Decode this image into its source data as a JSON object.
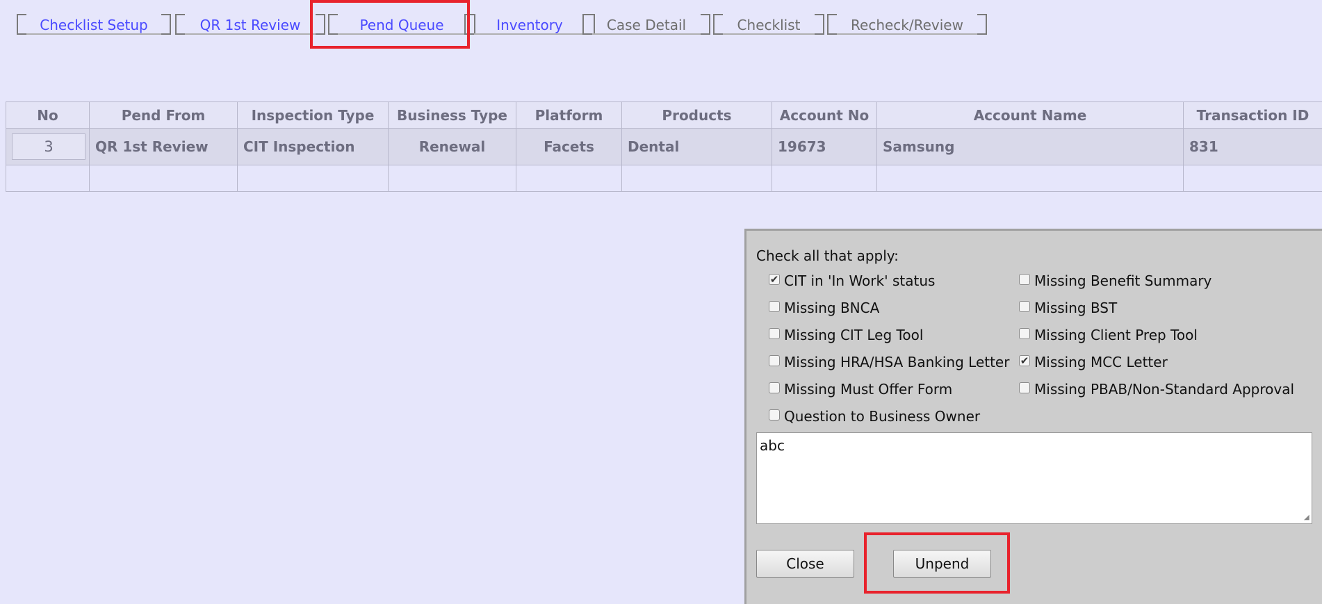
{
  "tabs": [
    {
      "label": "Checklist Setup"
    },
    {
      "label": "QR 1st Review"
    },
    {
      "label": "Pend Queue"
    },
    {
      "label": "Inventory"
    },
    {
      "label": "Case Detail"
    },
    {
      "label": "Checklist"
    },
    {
      "label": "Recheck/Review"
    }
  ],
  "table": {
    "headers": [
      "No",
      "Pend From",
      "Inspection Type",
      "Business Type",
      "Platform",
      "Products",
      "Account No",
      "Account Name",
      "Transaction ID"
    ],
    "row": {
      "no": "3",
      "pend_from": "QR 1st Review",
      "inspection_type": "CIT Inspection",
      "business_type": "Renewal",
      "platform": "Facets",
      "products": "Dental",
      "account_no": "19673",
      "account_name": "Samsung",
      "transaction_id": "831"
    }
  },
  "panel": {
    "title": "Check all that apply:",
    "checks": [
      {
        "label": "CIT in 'In Work' status",
        "mark": "✔"
      },
      {
        "label": "Missing Benefit Summary",
        "mark": ""
      },
      {
        "label": "Missing BNCA",
        "mark": ""
      },
      {
        "label": "Missing BST",
        "mark": ""
      },
      {
        "label": "Missing CIT Leg Tool",
        "mark": ""
      },
      {
        "label": "Missing Client Prep Tool",
        "mark": ""
      },
      {
        "label": "Missing HRA/HSA Banking Letter",
        "mark": ""
      },
      {
        "label": "Missing MCC Letter",
        "mark": "✔"
      },
      {
        "label": "Missing Must Offer Form",
        "mark": ""
      },
      {
        "label": "Missing PBAB/Non-Standard Approval",
        "mark": ""
      },
      {
        "label": "Question to Business Owner",
        "mark": ""
      }
    ],
    "comment": "abc",
    "close_label": "Close",
    "unpend_label": "Unpend"
  }
}
